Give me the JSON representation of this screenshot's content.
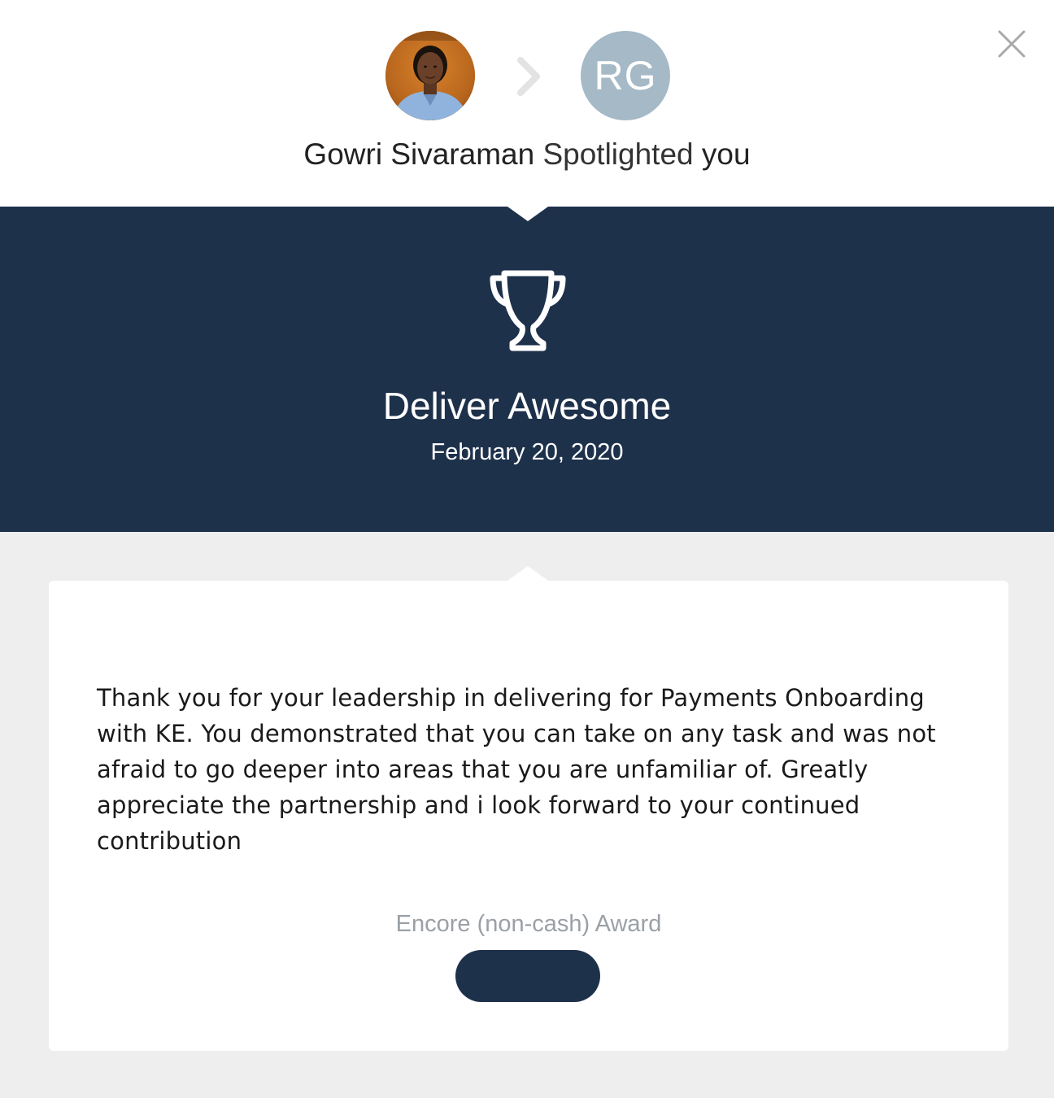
{
  "header": {
    "sender_photo_alt": "Gowri Sivaraman",
    "recipient_initials": "RG",
    "sender_name": "Gowri Sivaraman",
    "action_text": "Spotlighted",
    "recipient_text": "you"
  },
  "banner": {
    "icon": "trophy-icon",
    "award_title": "Deliver Awesome",
    "award_date": "February 20, 2020"
  },
  "card": {
    "message": "Thank you for your leadership in delivering for Payments Onboarding with KE. You demonstrated that you can take on any task and was not afraid to go deeper into areas that you are unfamiliar of. Greatly appreciate the partnership and i look forward to your continued contribution",
    "award_type": "Encore (non-cash) Award",
    "award_value": ""
  },
  "colors": {
    "navy": "#1e314b",
    "avatar_initials_bg": "#a5b9c6",
    "page_grey": "#eeeeee",
    "muted_text": "#9aa0a6"
  }
}
